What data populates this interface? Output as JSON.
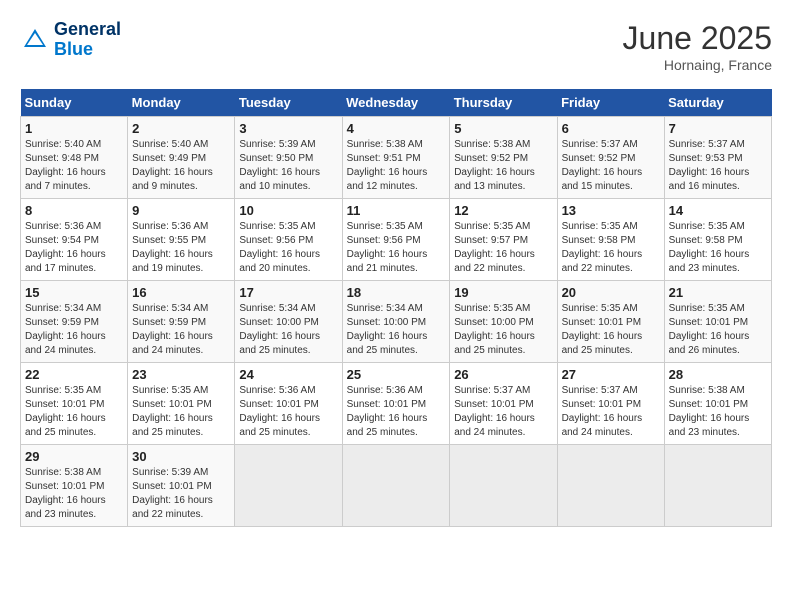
{
  "header": {
    "logo_line1": "General",
    "logo_line2": "Blue",
    "month": "June 2025",
    "location": "Hornaing, France"
  },
  "days_of_week": [
    "Sunday",
    "Monday",
    "Tuesday",
    "Wednesday",
    "Thursday",
    "Friday",
    "Saturday"
  ],
  "weeks": [
    [
      {
        "day": "1",
        "sunrise": "5:40 AM",
        "sunset": "9:48 PM",
        "daylight": "16 hours and 7 minutes."
      },
      {
        "day": "2",
        "sunrise": "5:40 AM",
        "sunset": "9:49 PM",
        "daylight": "16 hours and 9 minutes."
      },
      {
        "day": "3",
        "sunrise": "5:39 AM",
        "sunset": "9:50 PM",
        "daylight": "16 hours and 10 minutes."
      },
      {
        "day": "4",
        "sunrise": "5:38 AM",
        "sunset": "9:51 PM",
        "daylight": "16 hours and 12 minutes."
      },
      {
        "day": "5",
        "sunrise": "5:38 AM",
        "sunset": "9:52 PM",
        "daylight": "16 hours and 13 minutes."
      },
      {
        "day": "6",
        "sunrise": "5:37 AM",
        "sunset": "9:52 PM",
        "daylight": "16 hours and 15 minutes."
      },
      {
        "day": "7",
        "sunrise": "5:37 AM",
        "sunset": "9:53 PM",
        "daylight": "16 hours and 16 minutes."
      }
    ],
    [
      {
        "day": "8",
        "sunrise": "5:36 AM",
        "sunset": "9:54 PM",
        "daylight": "16 hours and 17 minutes."
      },
      {
        "day": "9",
        "sunrise": "5:36 AM",
        "sunset": "9:55 PM",
        "daylight": "16 hours and 19 minutes."
      },
      {
        "day": "10",
        "sunrise": "5:35 AM",
        "sunset": "9:56 PM",
        "daylight": "16 hours and 20 minutes."
      },
      {
        "day": "11",
        "sunrise": "5:35 AM",
        "sunset": "9:56 PM",
        "daylight": "16 hours and 21 minutes."
      },
      {
        "day": "12",
        "sunrise": "5:35 AM",
        "sunset": "9:57 PM",
        "daylight": "16 hours and 22 minutes."
      },
      {
        "day": "13",
        "sunrise": "5:35 AM",
        "sunset": "9:58 PM",
        "daylight": "16 hours and 22 minutes."
      },
      {
        "day": "14",
        "sunrise": "5:35 AM",
        "sunset": "9:58 PM",
        "daylight": "16 hours and 23 minutes."
      }
    ],
    [
      {
        "day": "15",
        "sunrise": "5:34 AM",
        "sunset": "9:59 PM",
        "daylight": "16 hours and 24 minutes."
      },
      {
        "day": "16",
        "sunrise": "5:34 AM",
        "sunset": "9:59 PM",
        "daylight": "16 hours and 24 minutes."
      },
      {
        "day": "17",
        "sunrise": "5:34 AM",
        "sunset": "10:00 PM",
        "daylight": "16 hours and 25 minutes."
      },
      {
        "day": "18",
        "sunrise": "5:34 AM",
        "sunset": "10:00 PM",
        "daylight": "16 hours and 25 minutes."
      },
      {
        "day": "19",
        "sunrise": "5:35 AM",
        "sunset": "10:00 PM",
        "daylight": "16 hours and 25 minutes."
      },
      {
        "day": "20",
        "sunrise": "5:35 AM",
        "sunset": "10:01 PM",
        "daylight": "16 hours and 25 minutes."
      },
      {
        "day": "21",
        "sunrise": "5:35 AM",
        "sunset": "10:01 PM",
        "daylight": "16 hours and 26 minutes."
      }
    ],
    [
      {
        "day": "22",
        "sunrise": "5:35 AM",
        "sunset": "10:01 PM",
        "daylight": "16 hours and 25 minutes."
      },
      {
        "day": "23",
        "sunrise": "5:35 AM",
        "sunset": "10:01 PM",
        "daylight": "16 hours and 25 minutes."
      },
      {
        "day": "24",
        "sunrise": "5:36 AM",
        "sunset": "10:01 PM",
        "daylight": "16 hours and 25 minutes."
      },
      {
        "day": "25",
        "sunrise": "5:36 AM",
        "sunset": "10:01 PM",
        "daylight": "16 hours and 25 minutes."
      },
      {
        "day": "26",
        "sunrise": "5:37 AM",
        "sunset": "10:01 PM",
        "daylight": "16 hours and 24 minutes."
      },
      {
        "day": "27",
        "sunrise": "5:37 AM",
        "sunset": "10:01 PM",
        "daylight": "16 hours and 24 minutes."
      },
      {
        "day": "28",
        "sunrise": "5:38 AM",
        "sunset": "10:01 PM",
        "daylight": "16 hours and 23 minutes."
      }
    ],
    [
      {
        "day": "29",
        "sunrise": "5:38 AM",
        "sunset": "10:01 PM",
        "daylight": "16 hours and 23 minutes."
      },
      {
        "day": "30",
        "sunrise": "5:39 AM",
        "sunset": "10:01 PM",
        "daylight": "16 hours and 22 minutes."
      },
      null,
      null,
      null,
      null,
      null
    ]
  ]
}
